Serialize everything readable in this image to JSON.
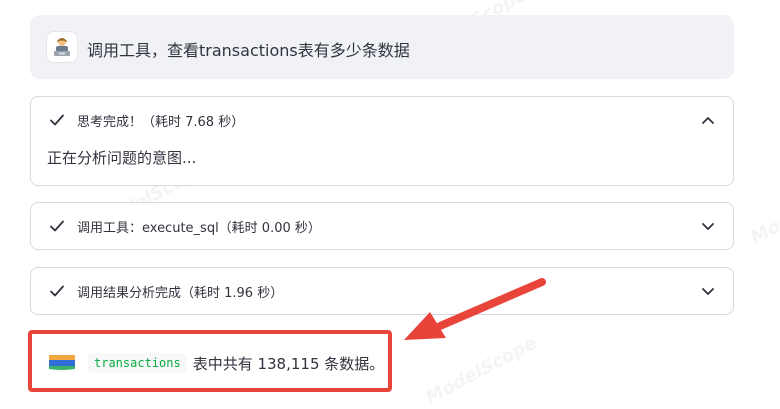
{
  "user_message": {
    "avatar_icon": "person-at-computer-icon",
    "text": "调用工具，查看transactions表有多少条数据"
  },
  "expanders": [
    {
      "label": "思考完成！（耗时 7.68 秒）",
      "expanded": true,
      "body": "正在分析问题的意图..."
    },
    {
      "label": "调用工具：execute_sql（耗时 0.00 秒）",
      "expanded": false
    },
    {
      "label": "调用结果分析完成（耗时 1.96 秒）",
      "expanded": false
    }
  ],
  "result": {
    "icon": "flag-icon",
    "table_name": "transactions",
    "text": "表中共有 138,115 条数据。"
  },
  "watermark": "ModelScope",
  "colors": {
    "highlight": "#e8443a",
    "code_text": "#09ab3b",
    "user_bg": "#f0f2f6",
    "border": "#d6d9df"
  }
}
